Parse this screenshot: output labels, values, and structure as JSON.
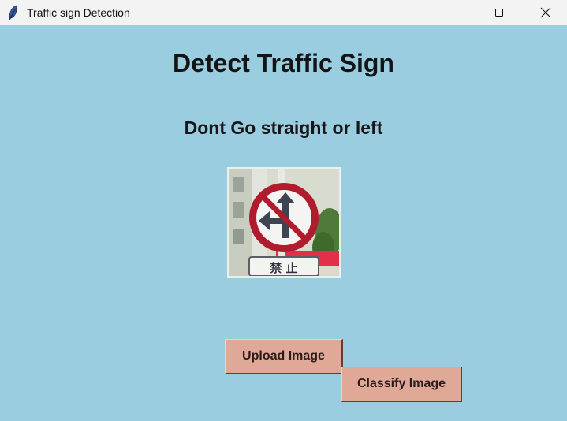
{
  "window": {
    "title": "Traffic sign Detection",
    "app_icon": "feather-icon",
    "controls": {
      "minimize_icon": "minimize-icon",
      "maximize_icon": "maximize-icon",
      "close_icon": "close-icon"
    }
  },
  "main": {
    "background_color": "#9bcde0",
    "heading": "Detect Traffic Sign",
    "result_label": "Dont Go straight or left",
    "image": {
      "description_text": "禁 止"
    },
    "buttons": {
      "upload_label": "Upload Image",
      "classify_label": "Classify Image",
      "button_color": "#e0a896"
    }
  }
}
